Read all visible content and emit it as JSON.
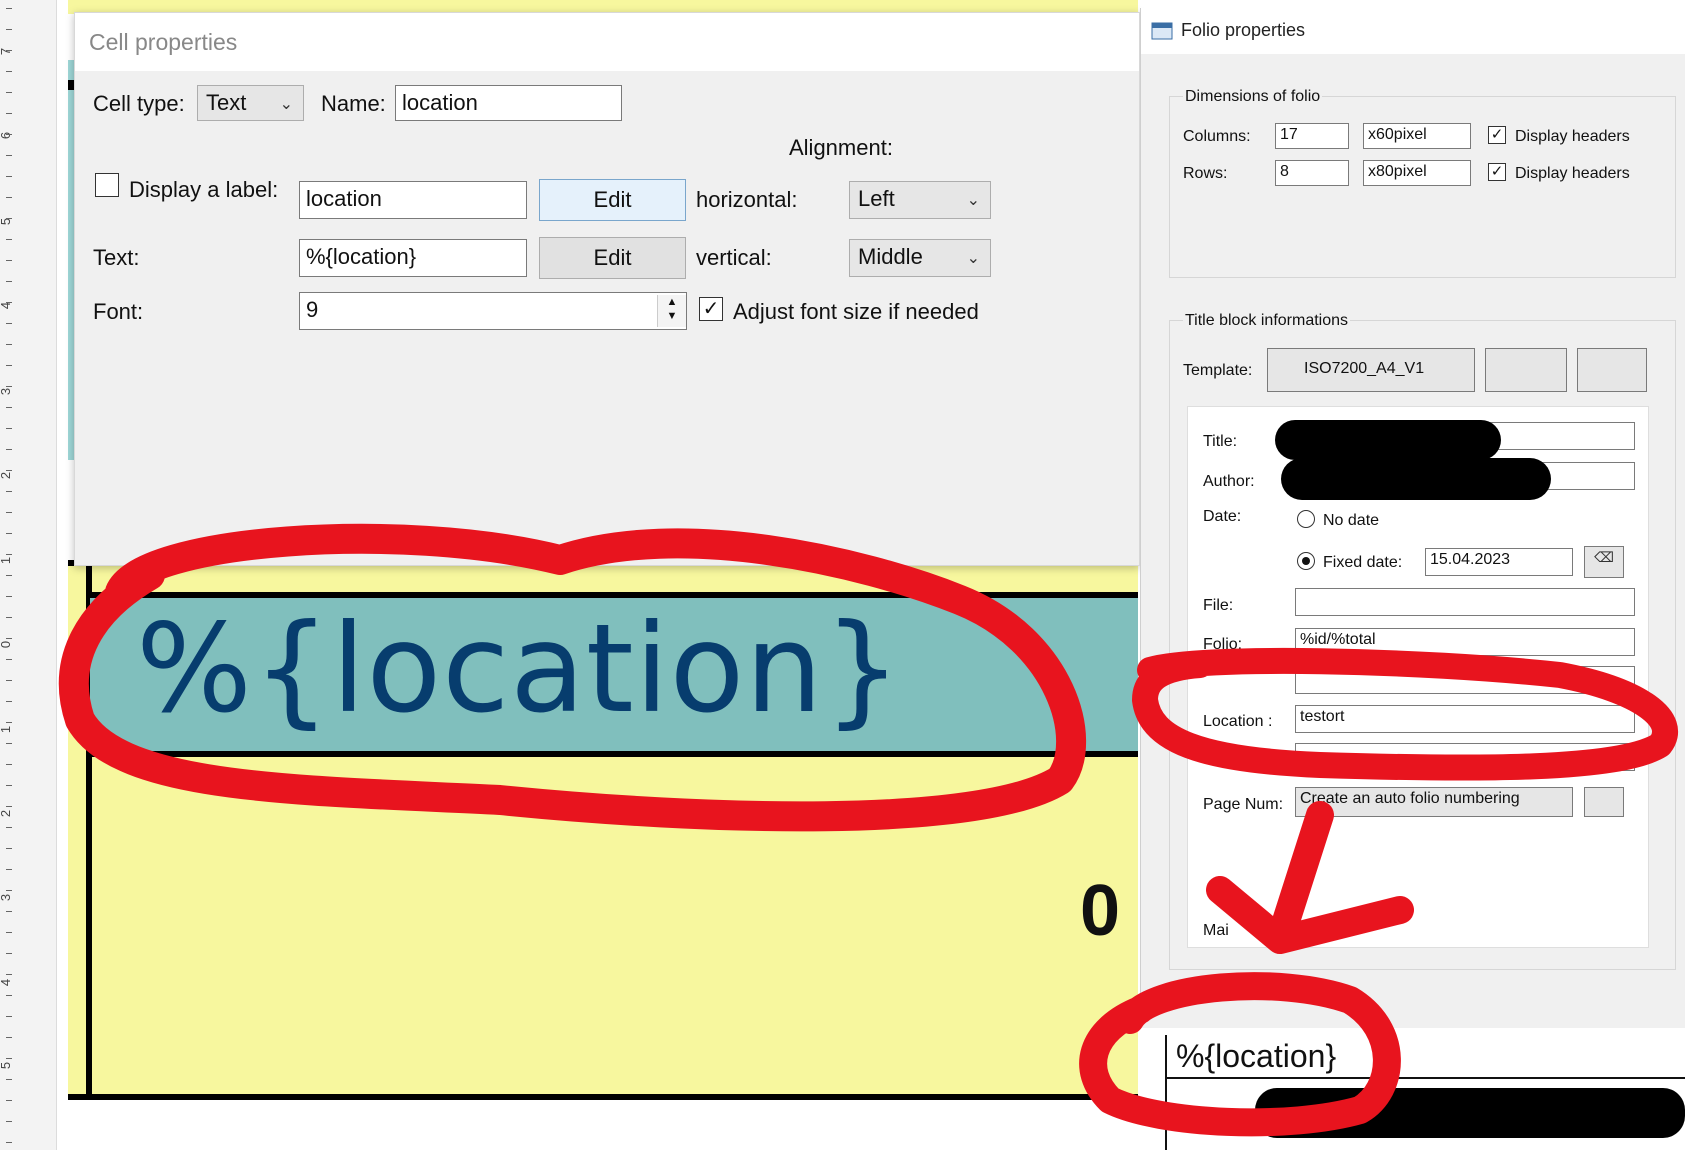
{
  "ruler": {
    "labels": [
      "7",
      "6",
      "5",
      "4",
      "3",
      "2",
      "1",
      "0",
      "1",
      "2",
      "3",
      "4",
      "5"
    ]
  },
  "cell_dialog": {
    "title": "Cell properties",
    "cell_type_label": "Cell type:",
    "cell_type_value": "Text",
    "name_label": "Name:",
    "name_value": "location",
    "alignment_label": "Alignment:",
    "display_label_text": "Display a label:",
    "display_label_checked": false,
    "label_value": "location",
    "edit_label_button": "Edit",
    "horizontal_label": "horizontal:",
    "horizontal_value": "Left",
    "text_label": "Text:",
    "text_value": "%{location}",
    "edit_text_button": "Edit",
    "vertical_label": "vertical:",
    "vertical_value": "Middle",
    "font_label": "Font:",
    "font_value": "9",
    "adjust_font_label": "Adjust font size if needed",
    "adjust_font_checked": true
  },
  "template_canvas": {
    "location_cell_text": "%{location}",
    "partial_text": "0"
  },
  "folio_dialog": {
    "title": "Folio properties",
    "dimensions_group": "Dimensions of folio",
    "columns_label": "Columns:",
    "columns_value": "17",
    "columns_unit": "x60pixel",
    "columns_display_headers": "Display headers",
    "rows_label": "Rows:",
    "rows_value": "8",
    "rows_unit": "x80pixel",
    "rows_display_headers": "Display headers",
    "titleblock_group": "Title block informations",
    "template_label": "Template:",
    "template_value": "ISO7200_A4_V1",
    "title_label": "Title:",
    "author_label": "Author:",
    "date_label": "Date:",
    "no_date_label": "No date",
    "fixed_date_label": "Fixed date:",
    "fixed_date_value": "15.04.2023",
    "file_label": "File:",
    "folio_label": "Folio:",
    "folio_value": "%id/%total",
    "location_label": "Location :",
    "location_value": "testort",
    "page_num_label": "Page Num:",
    "page_num_value": "Create an auto folio numbering",
    "main_label_partial": "Mai"
  },
  "preview": {
    "text": "%{location}"
  },
  "colors": {
    "annotation_red": "#e8141e",
    "template_yellow": "#f7f79e",
    "cell_teal": "#80bfbd",
    "cell_text_blue": "#073d6e"
  }
}
